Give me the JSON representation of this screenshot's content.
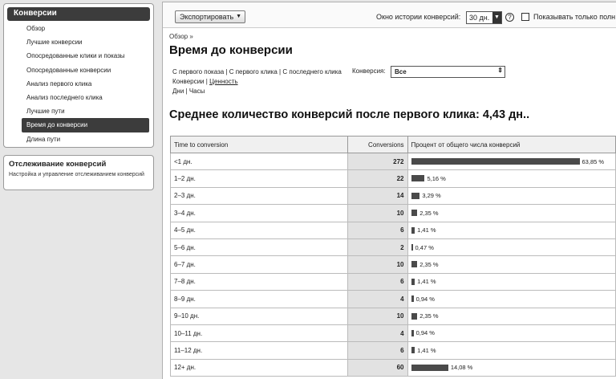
{
  "sidebar": {
    "header": "Конверсии",
    "items": [
      {
        "label": "Обзор"
      },
      {
        "label": "Лучшие конверсии"
      },
      {
        "label": "Опосредованные клики и показы"
      },
      {
        "label": "Опосредованные конверсии"
      },
      {
        "label": "Анализ первого клика"
      },
      {
        "label": "Анализ последнего клика"
      },
      {
        "label": "Лучшие пути"
      },
      {
        "label": "Время до конверсии",
        "active": true
      },
      {
        "label": "Длина пути"
      }
    ],
    "tracking": {
      "title": "Отслеживание конверсий",
      "desc": "Настройка и управление отслеживанием конверсий"
    }
  },
  "toolbar": {
    "export_label": "Экспортировать",
    "window_label": "Окно истории конверсий:",
    "days_value": "30 дн.",
    "checkbox_label": "Показывать только полн"
  },
  "breadcrumb": "Обзор »",
  "page_title": "Время до конверсии",
  "filters": {
    "first_impression": "С первого показа",
    "first_click": "С первого клика",
    "last_click": "С последнего клика",
    "conversions": "Конверсии",
    "value": "Ценность",
    "days": "Дни",
    "hours": "Часы",
    "conversion_label": "Конверсия:",
    "conversion_value": "Все"
  },
  "avg_title": "Среднее количество конверсий после первого клика: 4,43 дн..",
  "table": {
    "headers": [
      "Time to conversion",
      "Conversions",
      "Процент от общего числа конверсий"
    ],
    "rows": [
      {
        "label": "<1 дн.",
        "value": "272",
        "pct": "63,85 %",
        "fraction": 0.6385
      },
      {
        "label": "1–2 дн.",
        "value": "22",
        "pct": "5,16 %",
        "fraction": 0.0516
      },
      {
        "label": "2–3 дн.",
        "value": "14",
        "pct": "3,29 %",
        "fraction": 0.0329
      },
      {
        "label": "3–4 дн.",
        "value": "10",
        "pct": "2,35 %",
        "fraction": 0.0235
      },
      {
        "label": "4–5 дн.",
        "value": "6",
        "pct": "1,41 %",
        "fraction": 0.0141
      },
      {
        "label": "5–6 дн.",
        "value": "2",
        "pct": "0,47 %",
        "fraction": 0.0047
      },
      {
        "label": "6–7 дн.",
        "value": "10",
        "pct": "2,35 %",
        "fraction": 0.0235
      },
      {
        "label": "7–8 дн.",
        "value": "6",
        "pct": "1,41 %",
        "fraction": 0.0141
      },
      {
        "label": "8–9 дн.",
        "value": "4",
        "pct": "0,94 %",
        "fraction": 0.0094
      },
      {
        "label": "9–10 дн.",
        "value": "10",
        "pct": "2,35 %",
        "fraction": 0.0235
      },
      {
        "label": "10–11 дн.",
        "value": "4",
        "pct": "0,94 %",
        "fraction": 0.0094
      },
      {
        "label": "11–12 дн.",
        "value": "6",
        "pct": "1,41 %",
        "fraction": 0.0141
      },
      {
        "label": "12+ дн.",
        "value": "60",
        "pct": "14,08 %",
        "fraction": 0.1408
      }
    ]
  },
  "colors": {
    "bar": "#4a4a4a",
    "header_dark": "#3c3c3c"
  }
}
